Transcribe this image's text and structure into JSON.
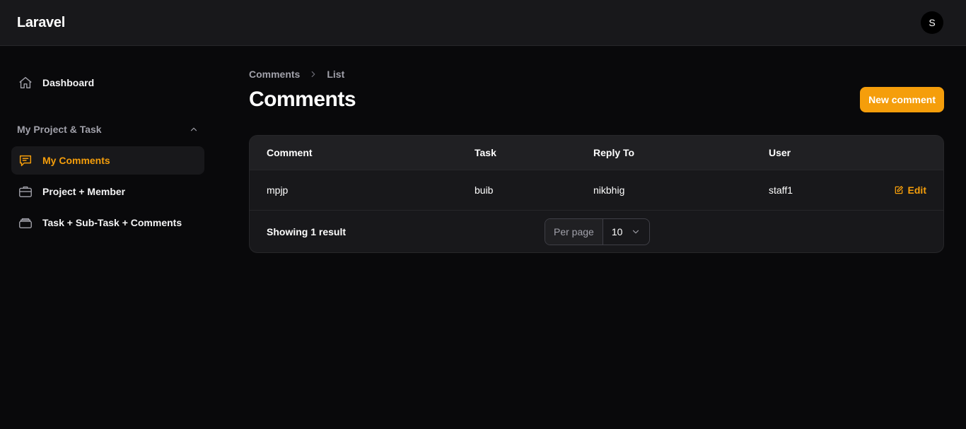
{
  "app": {
    "brand": "Laravel",
    "avatar_initial": "S"
  },
  "sidebar": {
    "dashboard": {
      "label": "Dashboard",
      "icon": "home-icon"
    },
    "group": {
      "label": "My Project & Task",
      "icon": "chevron-up-icon"
    },
    "items": [
      {
        "label": "My Comments",
        "icon": "chat-bubble-icon",
        "active": true
      },
      {
        "label": "Project + Member",
        "icon": "briefcase-icon",
        "active": false
      },
      {
        "label": "Task + Sub-Task + Comments",
        "icon": "stack-icon",
        "active": false
      }
    ]
  },
  "breadcrumb": {
    "parent": "Comments",
    "current": "List"
  },
  "page": {
    "title": "Comments",
    "new_button": "New comment"
  },
  "table": {
    "columns": [
      "Comment",
      "Task",
      "Reply To",
      "User"
    ],
    "rows": [
      {
        "comment": "mpjp",
        "task": "buib",
        "reply_to": "nikbhig",
        "user": "staff1",
        "action": "Edit"
      }
    ],
    "footer": {
      "summary": "Showing 1 result",
      "per_page_label": "Per page",
      "per_page_value": "10"
    }
  },
  "colors": {
    "accent": "#f59e0b",
    "background": "#09090b",
    "surface": "#18181b",
    "border": "#27272a"
  }
}
